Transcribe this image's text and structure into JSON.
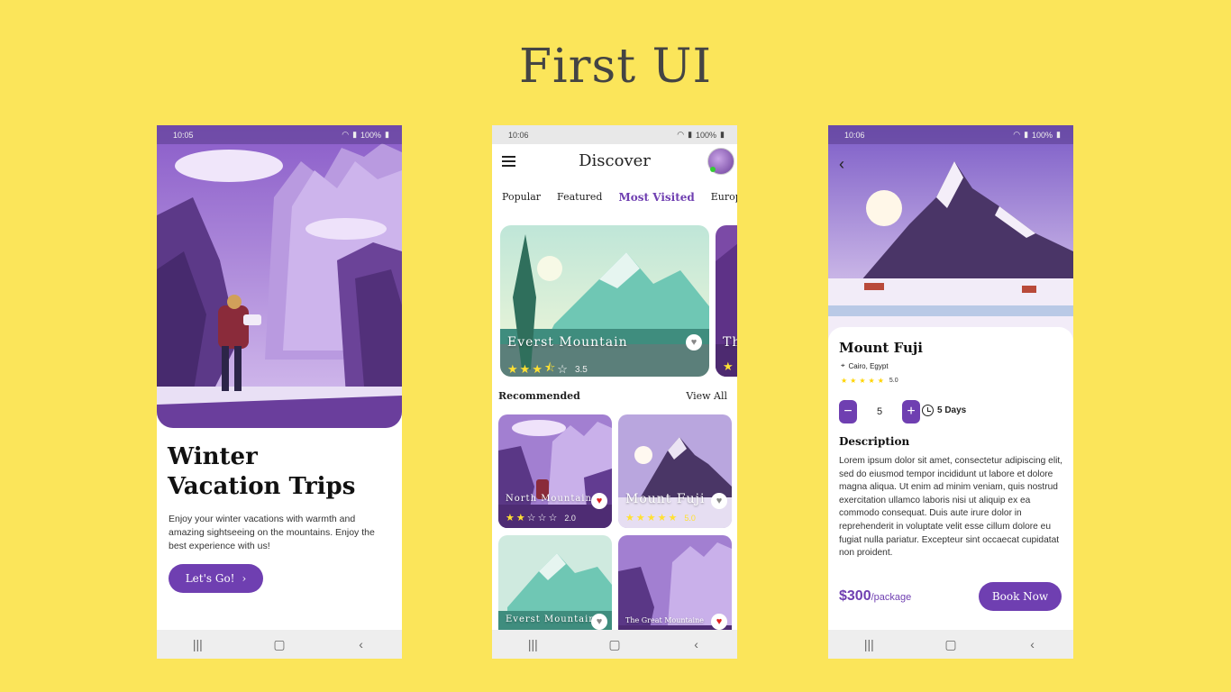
{
  "page_title": "First UI",
  "colors": {
    "background": "#fbe55a",
    "accent": "#6f3fb1",
    "star": "#ffe033"
  },
  "screen1": {
    "status": {
      "time": "10:05",
      "battery": "100%"
    },
    "heading_line1": "Winter",
    "heading_line2": "Vacation Trips",
    "body": "Enjoy your winter vacations with warmth and amazing sightseeing on the mountains. Enjoy the best experience with us!",
    "cta_label": "Let's Go!"
  },
  "screen2": {
    "status": {
      "time": "10:06",
      "battery": "100%"
    },
    "title": "Discover",
    "tabs": [
      "Popular",
      "Featured",
      "Most Visited",
      "Europe"
    ],
    "active_tab": "Most Visited",
    "featured": [
      {
        "title": "Everst Mountain",
        "rating": "3.5",
        "stars": 3.5,
        "favorite": false
      },
      {
        "title": "Th",
        "rating": "",
        "stars": 1,
        "favorite": false
      }
    ],
    "section_title": "Recommended",
    "view_all": "View All",
    "recommended": [
      {
        "title": "North Mountain",
        "rating": "2.0",
        "stars": 2,
        "favorite": true
      },
      {
        "title": "Mount Fuji",
        "rating": "5.0",
        "stars": 5,
        "favorite": false
      },
      {
        "title": "Everst Mountain",
        "favorite": false
      },
      {
        "title": "The Great Mountaine",
        "favorite": true
      }
    ]
  },
  "screen3": {
    "status": {
      "time": "10:06",
      "battery": "100%"
    },
    "title": "Mount Fuji",
    "location": "Cairo, Egypt",
    "rating": "5.0",
    "stars": 5,
    "quantity": "5",
    "duration": "5 Days",
    "description_heading": "Description",
    "description": "Lorem ipsum dolor sit amet, consectetur adipiscing elit, sed do eiusmod tempor incididunt ut labore et dolore magna aliqua. Ut enim ad minim veniam, quis nostrud exercitation ullamco laboris nisi ut aliquip ex ea commodo consequat. Duis aute irure dolor in reprehenderit in voluptate velit esse cillum dolore eu fugiat nulla pariatur. Excepteur sint occaecat cupidatat non proident.",
    "price": "$300",
    "price_unit": "/package",
    "book_label": "Book Now"
  }
}
